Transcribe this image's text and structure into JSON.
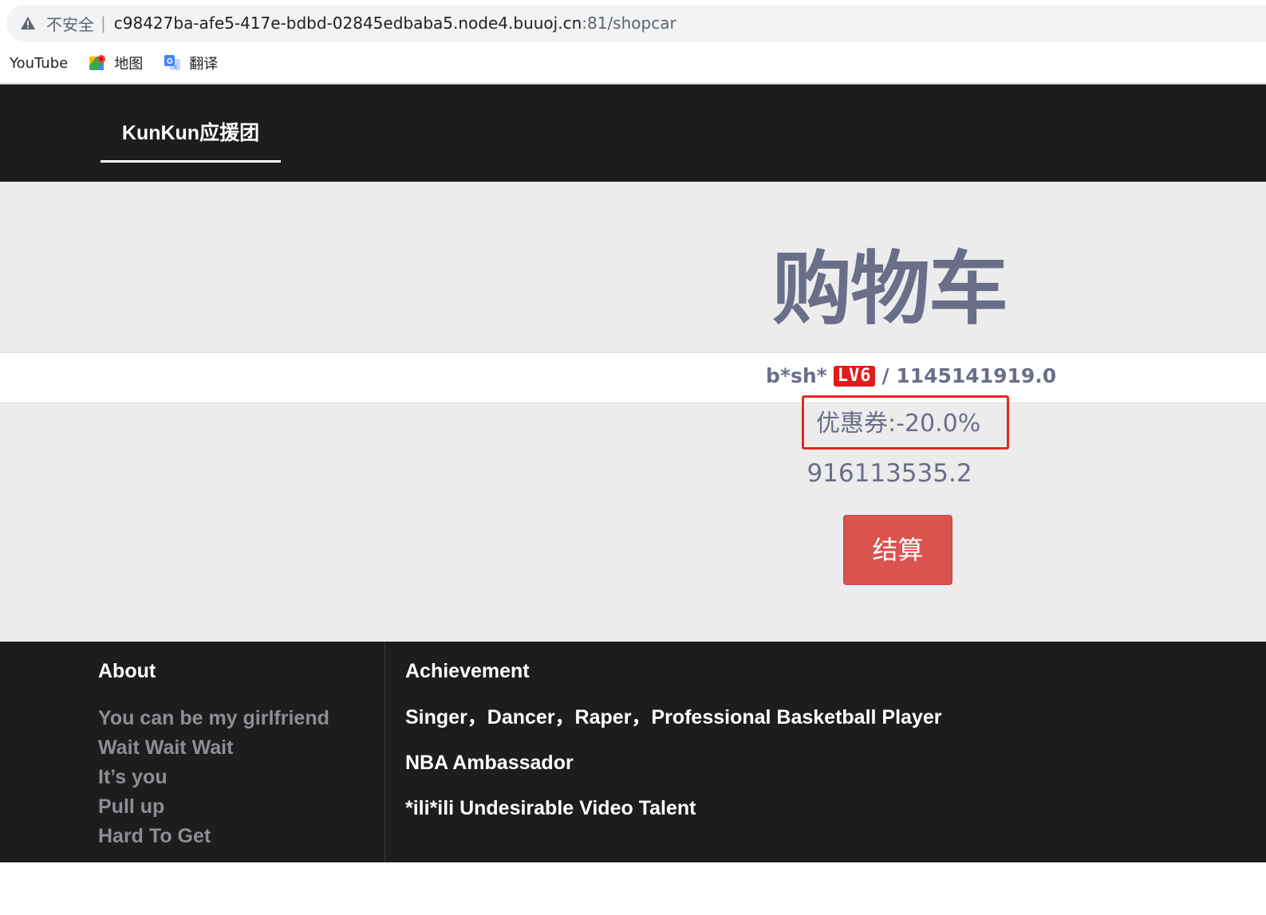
{
  "browser": {
    "insecure_label": "不安全",
    "url_host": "c98427ba-afe5-417e-bdbd-02845edbaba5.node4.buuoj.cn",
    "url_rest": ":81/shopcar",
    "bookmarks": [
      {
        "label": "YouTube",
        "icon": "youtube-icon"
      },
      {
        "label": "地图",
        "icon": "maps-icon"
      },
      {
        "label": "翻译",
        "icon": "translate-icon"
      }
    ]
  },
  "navbar": {
    "brand": "KunKun应援团"
  },
  "cart": {
    "title": "购物车",
    "username": "b*sh*",
    "level": "LV6",
    "balance": "/ 1145141919.0",
    "coupon": "优惠券:-20.0%",
    "total": "916113535.2",
    "checkout_label": "结算"
  },
  "footer": {
    "about_heading": "About",
    "about_links": [
      "You can be my girlfriend",
      "Wait Wait Wait",
      "It’s you",
      "Pull up",
      "Hard To Get"
    ],
    "achievement_heading": "Achievement",
    "achievements": [
      "Singer，Dancer，Raper，Professional Basketball Player",
      "NBA Ambassador",
      "*ili*ili Undesirable Video Talent"
    ]
  },
  "colors": {
    "nav_bg": "#1c1d1f",
    "main_bg": "#ececed",
    "accent_text": "#6b6e89",
    "checkout_red": "#d9534f",
    "highlight_border": "#e8261f"
  }
}
